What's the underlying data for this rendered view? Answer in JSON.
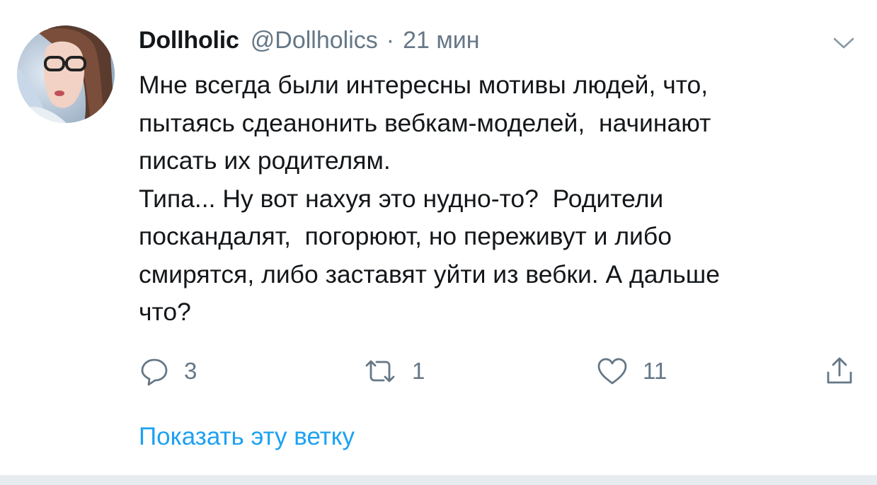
{
  "tweet": {
    "display_name": "Dollholic",
    "handle": "@Dollholics",
    "separator": "·",
    "time": "21 мин",
    "text_lines": [
      "Мне всегда были интересны мотивы людей, что,",
      "пытаясь сдеанонить вебкам-моделей,  начинают",
      "писать их родителям.",
      "Типа... Ну вот нахуя это нудно-то?  Родители",
      "поскандалят,  погорюют, но переживут и либо",
      "смирятся, либо заставят уйти из вебки. А дальше",
      "что?"
    ]
  },
  "actions": {
    "reply_count": "3",
    "retweet_count": "1",
    "like_count": "11"
  },
  "show_thread_label": "Показать эту ветку",
  "icons": {
    "reply": "reply-icon",
    "retweet": "retweet-icon",
    "like": "heart-icon",
    "share": "share-icon",
    "menu": "chevron-down-icon"
  },
  "colors": {
    "text": "#14171a",
    "secondary": "#657786",
    "accent": "#1da1f2",
    "divider": "#e6ecf0"
  }
}
